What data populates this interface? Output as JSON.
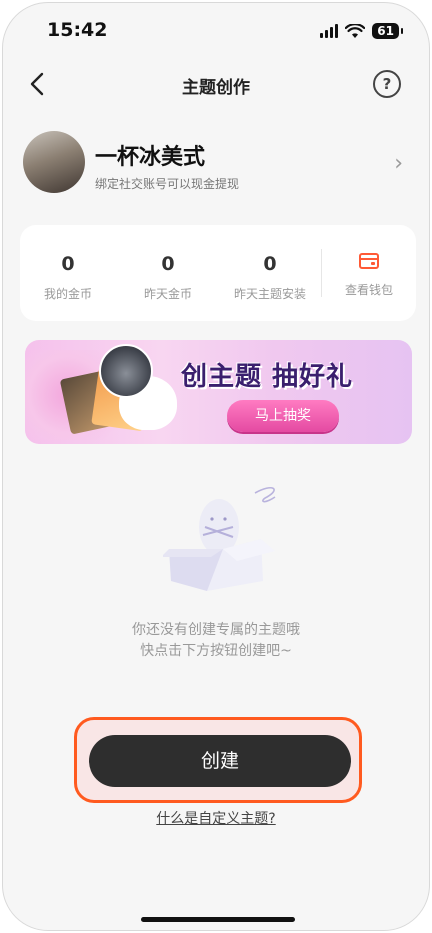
{
  "status": {
    "time": "15:42",
    "battery": "61"
  },
  "nav": {
    "title": "主题创作",
    "help_glyph": "?"
  },
  "profile": {
    "name": "一杯冰美式",
    "subtitle": "绑定社交账号可以现金提现"
  },
  "stats": [
    {
      "value": "0",
      "label": "我的金币"
    },
    {
      "value": "0",
      "label": "昨天金币"
    },
    {
      "value": "0",
      "label": "昨天主题安装"
    }
  ],
  "wallet": {
    "label": "查看钱包",
    "icon": "wallet-icon",
    "color": "#ff5a36"
  },
  "banner": {
    "headline": "创主题 抽好礼",
    "cta": "马上抽奖"
  },
  "empty": {
    "line1": "你还没有创建专属的主题哦",
    "line2": "快点击下方按钮创建吧~"
  },
  "actions": {
    "create_label": "创建",
    "help_link": "什么是自定义主题?"
  },
  "colors": {
    "accent": "#ff5a1f",
    "button": "#2e2e2e",
    "banner_cta": "#e44aa2"
  }
}
